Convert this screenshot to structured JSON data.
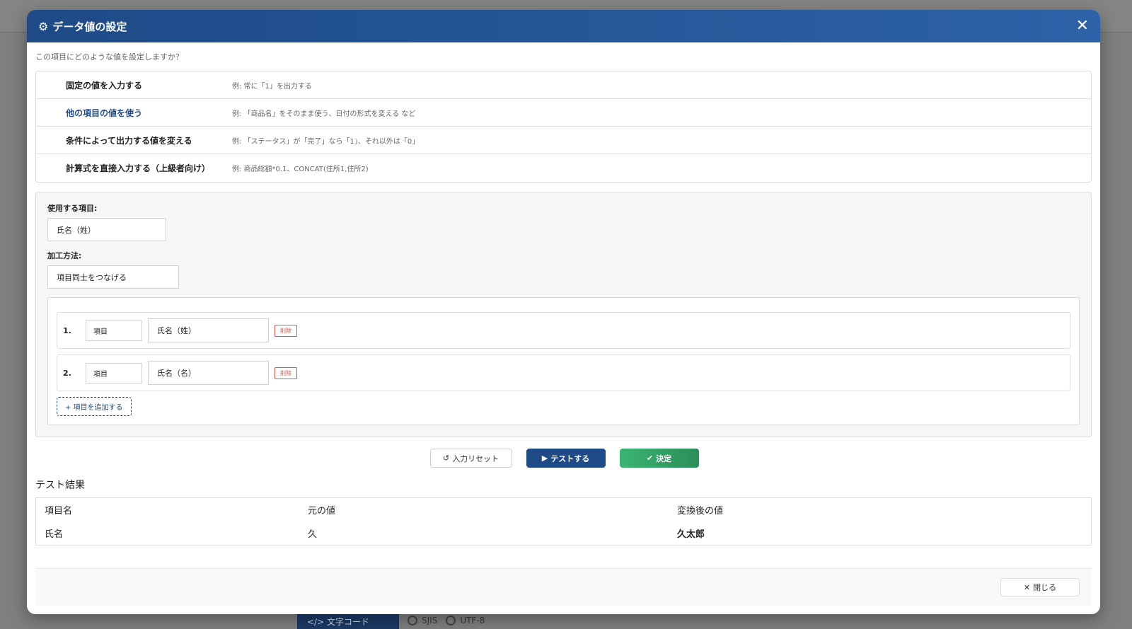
{
  "modal": {
    "title": "データ値の設定",
    "question": "この項目にどのような値を設定しますか？"
  },
  "options": [
    {
      "label": "固定の値を入力する",
      "example": "例: 常に「1」を出力する"
    },
    {
      "label": "他の項目の値を使う",
      "example": "例: 「商品名」をそのまま使う、日付の形式を変える など"
    },
    {
      "label": "条件によって出力する値を変える",
      "example": "例: 「ステータス」が「完了」なら「1」、それ以外は「0」"
    },
    {
      "label": "計算式を直接入力する（上級者向け）",
      "example": "例: 商品総額*0.1、CONCAT(住所1,住所2)"
    }
  ],
  "config": {
    "use_field_label": "使用する項目:",
    "use_field_value": "氏名（姓）",
    "method_label": "加工方法:",
    "method_value": "項目同士をつなげる",
    "rows": [
      {
        "num": "1.",
        "type": "項目",
        "value": "氏名（姓）",
        "delete": "削除"
      },
      {
        "num": "2.",
        "type": "項目",
        "value": "氏名（名）",
        "delete": "削除"
      }
    ],
    "add_label": "+ 項目を追加する"
  },
  "actions": {
    "reset": "入力リセット",
    "test": "テストする",
    "ok": "決定"
  },
  "result": {
    "title": "テスト結果",
    "headers": [
      "項目名",
      "元の値",
      "変換後の値"
    ],
    "row": [
      "氏名",
      "久",
      "久太郎"
    ]
  },
  "footer": {
    "close": "閉じる"
  },
  "background": {
    "tab": "文字コード",
    "radio1": "SJIS",
    "radio2": "UTF-8"
  },
  "colors": {
    "header": "#1e4a87",
    "active": "#1e4a87",
    "ok": "#3bb574",
    "danger": "#d9534f"
  }
}
